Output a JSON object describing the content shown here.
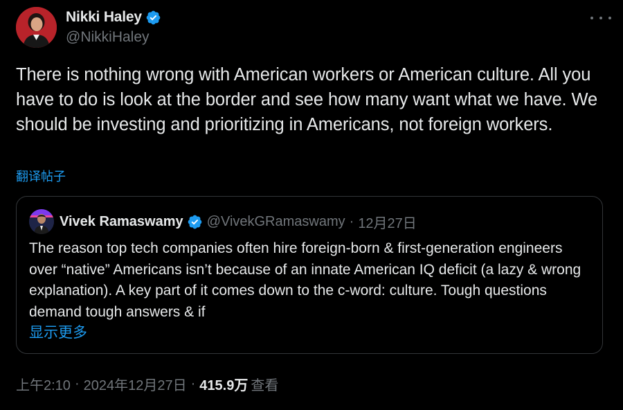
{
  "tweet": {
    "author_name": "Nikki Haley",
    "author_handle": "@NikkiHaley",
    "avatar_icon": "person-avatar",
    "text": "There is nothing wrong with American workers or American culture. All you have to do is look at the border and see how many want what we have. We should be investing and prioritizing in Americans, not foreign workers.",
    "translate_label": "翻译帖子"
  },
  "quote": {
    "author_name": "Vivek Ramaswamy",
    "author_handle": "@VivekGRamaswamy",
    "date": "12月27日",
    "separator": "·",
    "text": "The reason top tech companies often hire foreign-born & first-generation engineers over “native” Americans isn’t because of an innate American IQ deficit (a lazy & wrong explanation). A key part of it comes down to the c-word: culture. Tough questions demand tough answers & if",
    "show_more_label": "显示更多"
  },
  "footer": {
    "time": "上午2:10",
    "date": "2024年12月27日",
    "separator": "·",
    "views_count": "415.9万",
    "views_label": "查看"
  },
  "colors": {
    "background": "#000000",
    "text": "#e7e9ea",
    "muted": "#71767b",
    "accent": "#1d9bf0",
    "border": "#333639"
  }
}
